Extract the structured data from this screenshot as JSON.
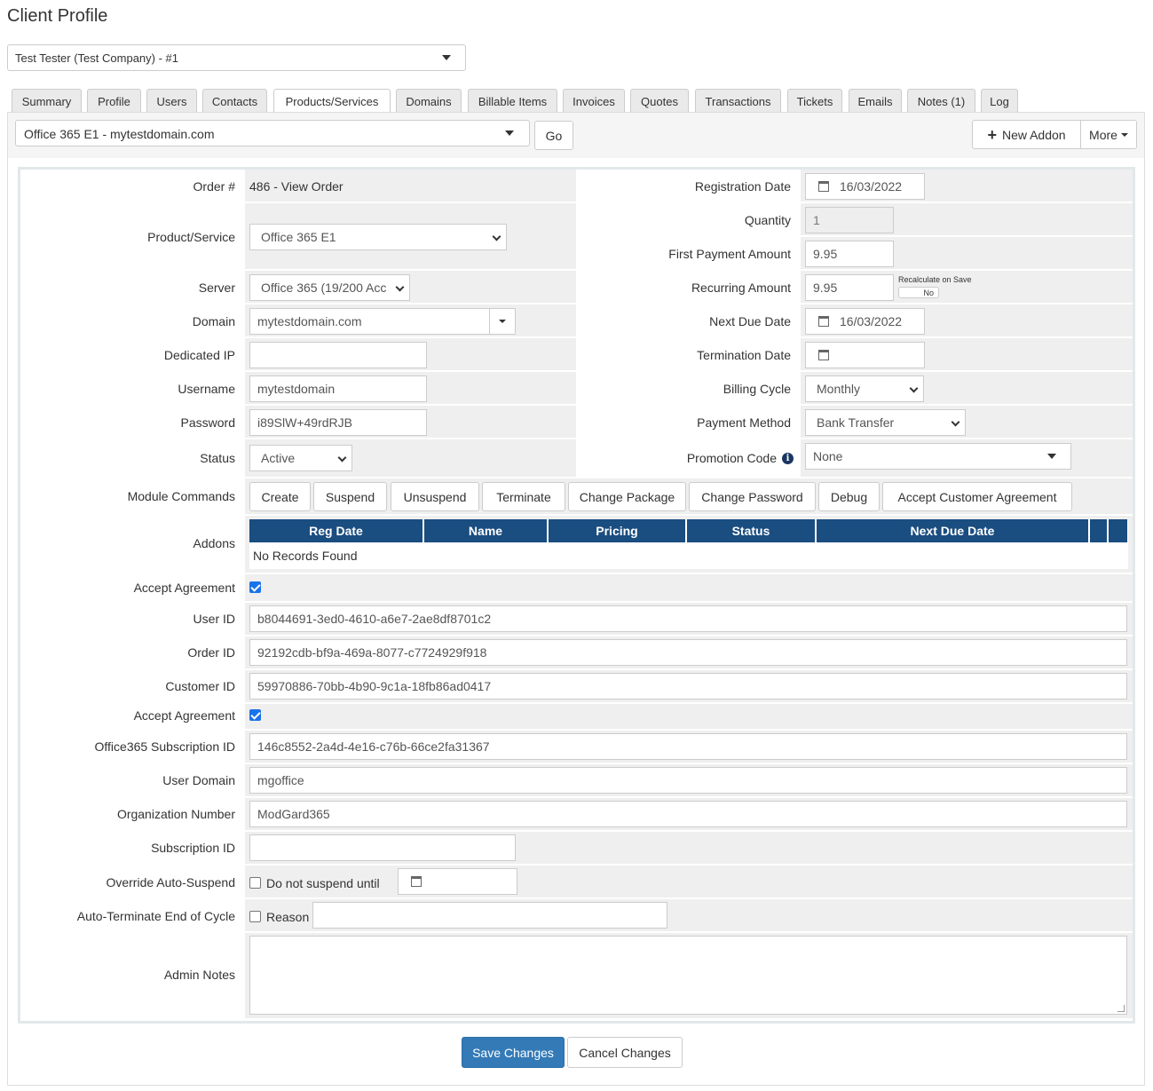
{
  "page": {
    "title": "Client Profile"
  },
  "client_select": {
    "value": "Test Tester (Test Company) - #1"
  },
  "tabs": [
    {
      "label": "Summary"
    },
    {
      "label": "Profile"
    },
    {
      "label": "Users"
    },
    {
      "label": "Contacts"
    },
    {
      "label": "Products/Services"
    },
    {
      "label": "Domains"
    },
    {
      "label": "Billable Items"
    },
    {
      "label": "Invoices"
    },
    {
      "label": "Quotes"
    },
    {
      "label": "Transactions"
    },
    {
      "label": "Tickets"
    },
    {
      "label": "Emails"
    },
    {
      "label": "Notes (1)"
    },
    {
      "label": "Log"
    }
  ],
  "active_tab": "Products/Services",
  "service_bar": {
    "selected_service": "Office 365 E1 - mytestdomain.com",
    "go_label": "Go",
    "new_addon_label": "New Addon",
    "more_label": "More"
  },
  "left": {
    "order_label": "Order #",
    "order_value": "486 - View Order",
    "product_label": "Product/Service",
    "product_value": "Office 365 E1",
    "server_label": "Server",
    "server_value": "Office 365 (19/200 Acc",
    "domain_label": "Domain",
    "domain_value": "mytestdomain.com",
    "dedicated_ip_label": "Dedicated IP",
    "dedicated_ip_value": "",
    "username_label": "Username",
    "username_value": "mytestdomain",
    "password_label": "Password",
    "password_value": "i89SlW+49rdRJB",
    "status_label": "Status",
    "status_value": "Active"
  },
  "right": {
    "reg_date_label": "Registration Date",
    "reg_date_value": "16/03/2022",
    "quantity_label": "Quantity",
    "quantity_value": "1",
    "first_payment_label": "First Payment Amount",
    "first_payment_value": "9.95",
    "recurring_label": "Recurring Amount",
    "recurring_value": "9.95",
    "recalc_label": "Recalculate on Save",
    "recalc_toggle": "No",
    "next_due_label": "Next Due Date",
    "next_due_value": "16/03/2022",
    "termination_label": "Termination Date",
    "termination_value": "",
    "billing_cycle_label": "Billing Cycle",
    "billing_cycle_value": "Monthly",
    "payment_method_label": "Payment Method",
    "payment_method_value": "Bank Transfer",
    "promo_label": "Promotion Code",
    "promo_value": "None"
  },
  "module_commands": {
    "label": "Module Commands",
    "buttons": [
      {
        "label": "Create"
      },
      {
        "label": "Suspend"
      },
      {
        "label": "Unsuspend"
      },
      {
        "label": "Terminate"
      },
      {
        "label": "Change Package"
      },
      {
        "label": "Change Password"
      },
      {
        "label": "Debug"
      },
      {
        "label": "Accept Customer Agreement"
      }
    ]
  },
  "addons": {
    "label": "Addons",
    "columns": [
      "Reg Date",
      "Name",
      "Pricing",
      "Status",
      "Next Due Date"
    ],
    "empty_text": "No Records Found"
  },
  "custom_fields": {
    "accept_agreement_label": "Accept Agreement",
    "accept_agreement_checked": true,
    "user_id_label": "User ID",
    "user_id_value": "b8044691-3ed0-4610-a6e7-2ae8df8701c2",
    "order_id_label": "Order ID",
    "order_id_value": "92192cdb-bf9a-469a-8077-c7724929f918",
    "customer_id_label": "Customer ID",
    "customer_id_value": "59970886-70bb-4b90-9c1a-18fb86ad0417",
    "accept_agreement2_label": "Accept Agreement",
    "accept_agreement2_checked": true,
    "sub_id_label": "Office365 Subscription ID",
    "sub_id_value": "146c8552-2a4d-4e16-c76b-66ce2fa31367",
    "user_domain_label": "User Domain",
    "user_domain_value": "mgoffice",
    "org_number_label": "Organization Number",
    "org_number_value": "ModGard365",
    "subscription_id_label": "Subscription ID",
    "subscription_id_value": ""
  },
  "override": {
    "label": "Override Auto-Suspend",
    "checkbox_label": "Do not suspend until",
    "date_value": ""
  },
  "auto_terminate": {
    "label": "Auto-Terminate End of Cycle",
    "reason_label": "Reason",
    "reason_value": ""
  },
  "admin_notes": {
    "label": "Admin Notes",
    "value": ""
  },
  "footer": {
    "save_label": "Save Changes",
    "cancel_label": "Cancel Changes"
  },
  "colors": {
    "table_header": "#1a4d80",
    "primary_button": "#337ab7",
    "checkbox": "#1a73e8"
  }
}
